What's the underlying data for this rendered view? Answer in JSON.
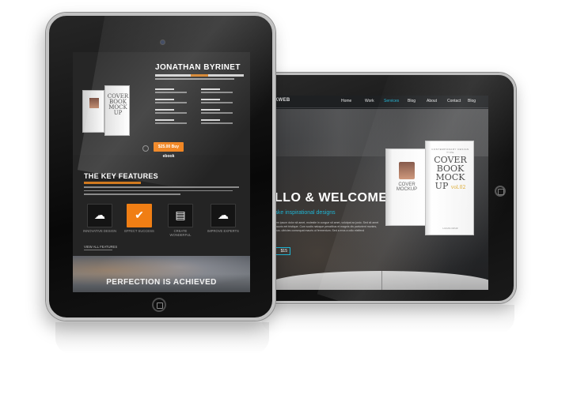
{
  "back_tablet": {
    "site_logo": "KWEB",
    "site_tagline": "",
    "nav": [
      "Home",
      "Work",
      "Services",
      "Blog",
      "About",
      "Contact",
      "Blog"
    ],
    "active_nav_index": 2,
    "hero_heading": "LLO & WELCOME",
    "hero_subheading": "ake inspirational designs",
    "hero_paragraph": "tem ipsum dolor sit amet, molestie in congue sit amet, volutpat ac justo. Sed sit amet mauris eet tristique. Cum sociis natoque penatibus et magnis dis parturient montes, mus. ultricies consequat mauris ut fermentum. Sed a eros a odio eleifend",
    "price_button": "$15",
    "book_small_title": "COVER MOCKUP",
    "book_large_top": "CONTEMPORARY DESIGN TYPE",
    "book_large_title_lines": [
      "COVER",
      "BOOK",
      "MOCK",
      "UP"
    ],
    "book_large_volume": "vol.02",
    "book_large_author": "LUCAS CRUZ"
  },
  "front_tablet": {
    "author_name": "JONATHAN BYRINET",
    "book_title_lines": [
      "COVER",
      "BOOK",
      "MOCK",
      "UP"
    ],
    "buy_button": "$25.00 Buy ebook",
    "features_title": "THE KEY FEATURES",
    "features": [
      {
        "icon": "cloud-upload-icon",
        "glyph": "☁",
        "label": "INNOVATIVE DESIGN",
        "highlight": false
      },
      {
        "icon": "checkmark-icon",
        "glyph": "✔",
        "label": "EFFECT SUCCESS",
        "highlight": true
      },
      {
        "icon": "browser-window-icon",
        "glyph": "▤",
        "label": "CREATE WONDERFUL",
        "highlight": false
      },
      {
        "icon": "cloud-refresh-icon",
        "glyph": "☁",
        "label": "IMPROVE EXPERTS",
        "highlight": false
      }
    ],
    "view_all": "VIEW ALL FEATURES",
    "banner_text": "PERFECTION IS ACHIEVED"
  },
  "colors": {
    "accent_orange": "#f07e14",
    "accent_cyan": "#1fb6d6",
    "screen_dark": "#242424"
  }
}
